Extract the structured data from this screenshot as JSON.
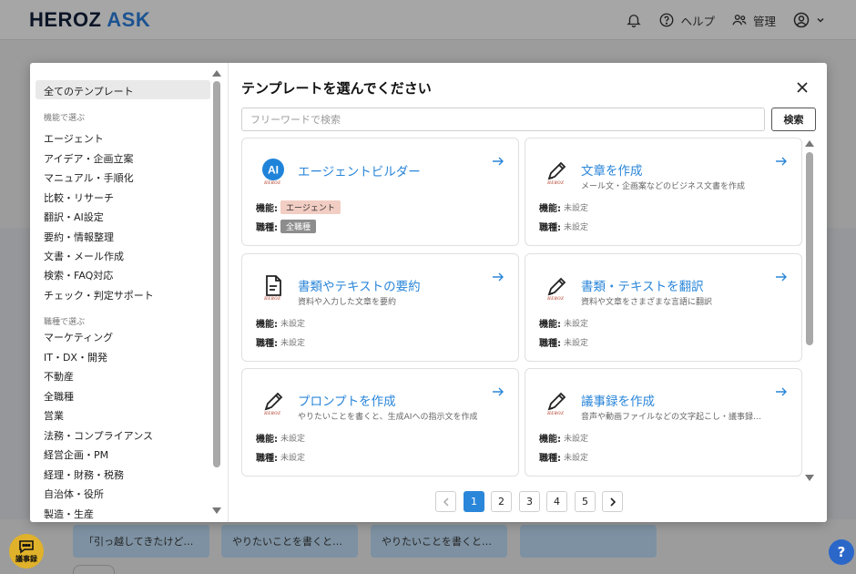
{
  "app": {
    "logo_main": "HEROZ",
    "logo_ask": "ASK",
    "nav": {
      "help": "ヘルプ",
      "admin": "管理"
    },
    "accent": "#2a86d9"
  },
  "background": {
    "cards": [
      "「引っ越してきたけど…",
      "やりたいことを書くと…",
      "やりたいことを書くと…"
    ],
    "fab_left": "議事録",
    "fab_right": "?"
  },
  "sidebar": {
    "all": "全てのテンプレート",
    "function_heading": "機能で選ぶ",
    "functions": [
      "エージェント",
      "アイデア・企画立案",
      "マニュアル・手順化",
      "比較・リサーチ",
      "翻訳・AI設定",
      "要約・情報整理",
      "文書・メール作成",
      "検索・FAQ対応",
      "チェック・判定サポート"
    ],
    "job_heading": "職種で選ぶ",
    "jobs": [
      "マーケティング",
      "IT・DX・開発",
      "不動産",
      "全職種",
      "営業",
      "法務・コンプライアンス",
      "経営企画・PM",
      "経理・財務・税務",
      "自治体・役所",
      "製造・生産"
    ]
  },
  "modal": {
    "title": "テンプレートを選んでください",
    "search_placeholder": "フリーワードで検索",
    "search_button": "検索",
    "label_function": "機能:",
    "label_job": "職種:",
    "unset": "未設定",
    "heroz_badge": "HEROZ",
    "ai_badge": "AI"
  },
  "cards": [
    {
      "title": "エージェントビルダー",
      "desc": "",
      "icon": "ai-badge-icon",
      "function": "エージェント",
      "job": "全職種"
    },
    {
      "title": "文章を作成",
      "desc": "メール文・企画案などのビジネス文書を作成",
      "icon": "pencil-icon",
      "function": "未設定",
      "job": "未設定"
    },
    {
      "title": "書類やテキストの要約",
      "desc": "資料や入力した文章を要約",
      "icon": "document-icon",
      "function": "未設定",
      "job": "未設定"
    },
    {
      "title": "書類・テキストを翻訳",
      "desc": "資料や文章をさまざまな言語に翻訳",
      "icon": "pencil-icon",
      "function": "未設定",
      "job": "未設定"
    },
    {
      "title": "プロンプトを作成",
      "desc": "やりたいことを書くと、生成AIへの指示文を作成",
      "icon": "pencil-icon",
      "function": "未設定",
      "job": "未設定"
    },
    {
      "title": "議事録を作成",
      "desc": "音声や動画ファイルなどの文字起こし・議事録…",
      "icon": "pencil-icon",
      "function": "未設定",
      "job": "未設定"
    }
  ],
  "pagination": {
    "pages": [
      "1",
      "2",
      "3",
      "4",
      "5"
    ],
    "current": "1"
  }
}
